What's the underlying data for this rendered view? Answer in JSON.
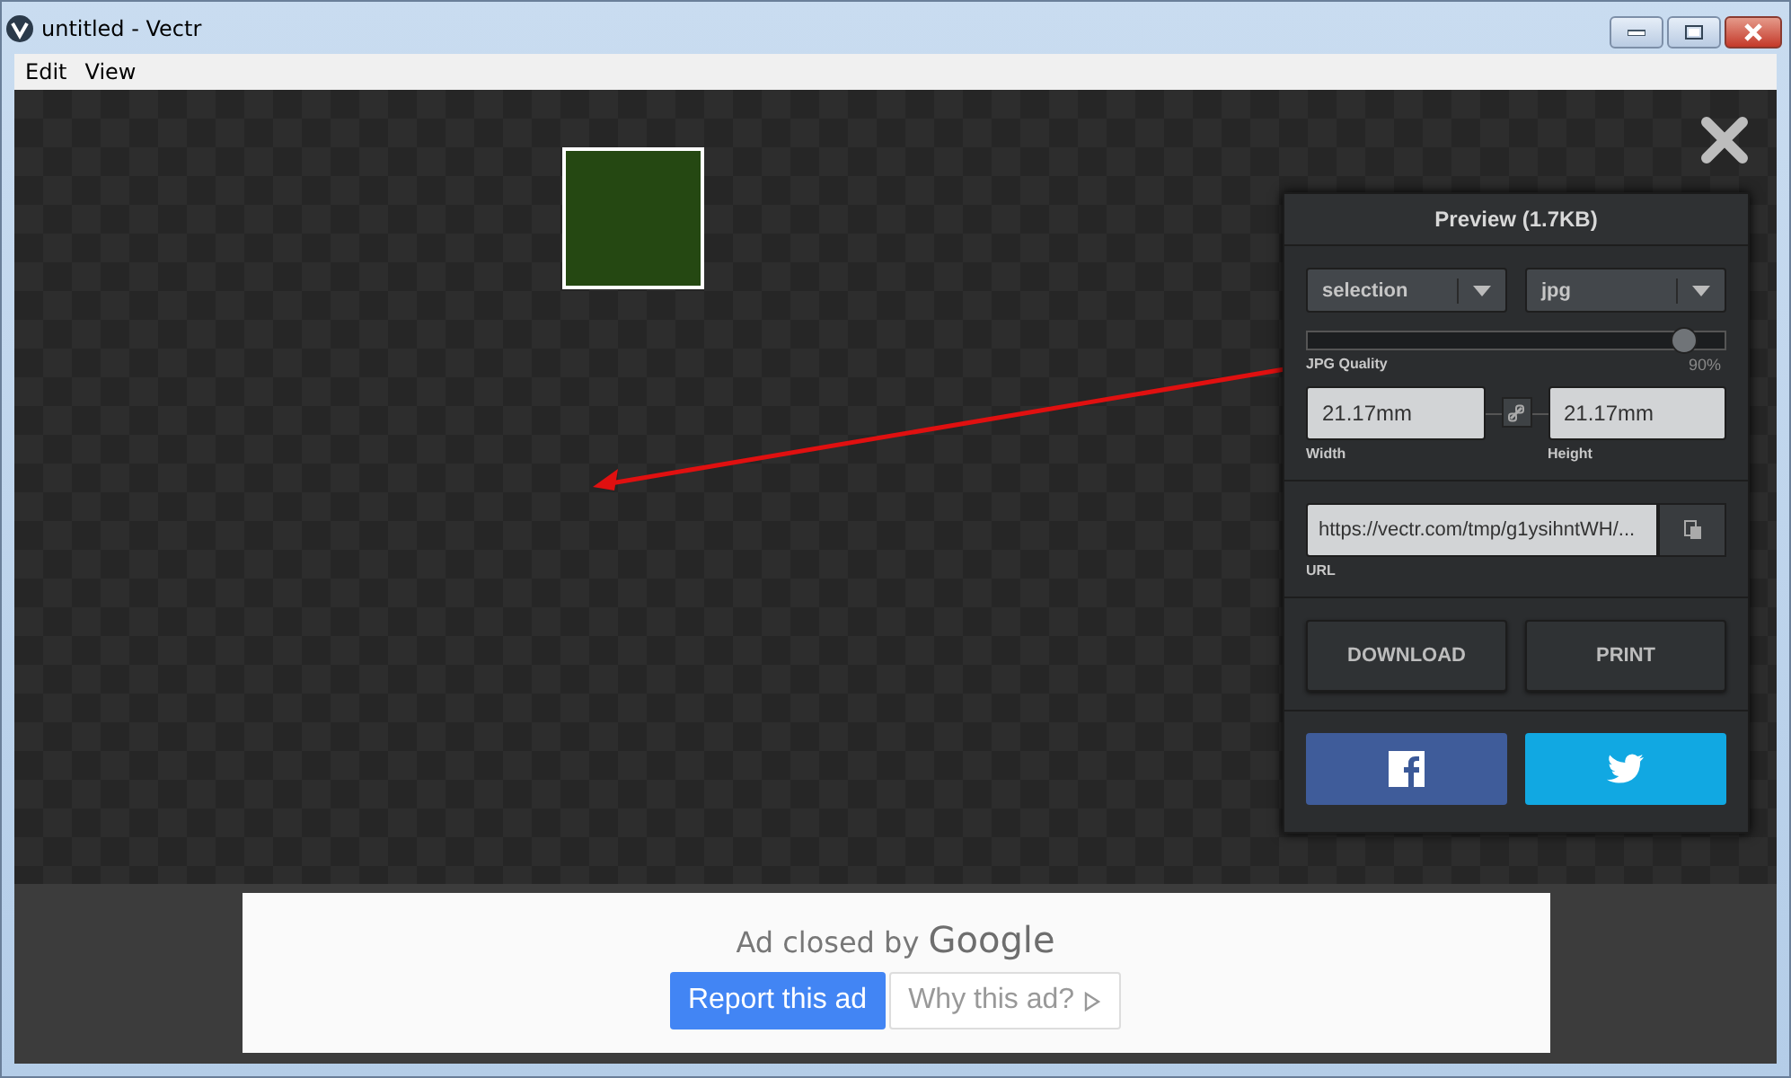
{
  "window": {
    "title": "untitled - Vectr"
  },
  "menu": [
    "Edit",
    "View"
  ],
  "preview": {
    "title": "Preview (1.7KB)",
    "dropdowns": [
      {
        "value": "selection"
      },
      {
        "value": "jpg"
      }
    ],
    "quality": {
      "label": "JPG Quality",
      "level": 0.9,
      "reading": "90%"
    },
    "width": {
      "value": "21.17mm",
      "label": "Width"
    },
    "height": {
      "value": "21.17mm",
      "label": "Height"
    },
    "url": {
      "value": "https://vectr.com/tmp/g1ysihntWH/...",
      "label": "URL"
    },
    "buttons": [
      "DOWNLOAD",
      "PRINT"
    ]
  },
  "ad": {
    "message": "Ad closed by ",
    "brand": "Google",
    "report_button": "Report this ad",
    "why_button": "Why this ad?"
  }
}
